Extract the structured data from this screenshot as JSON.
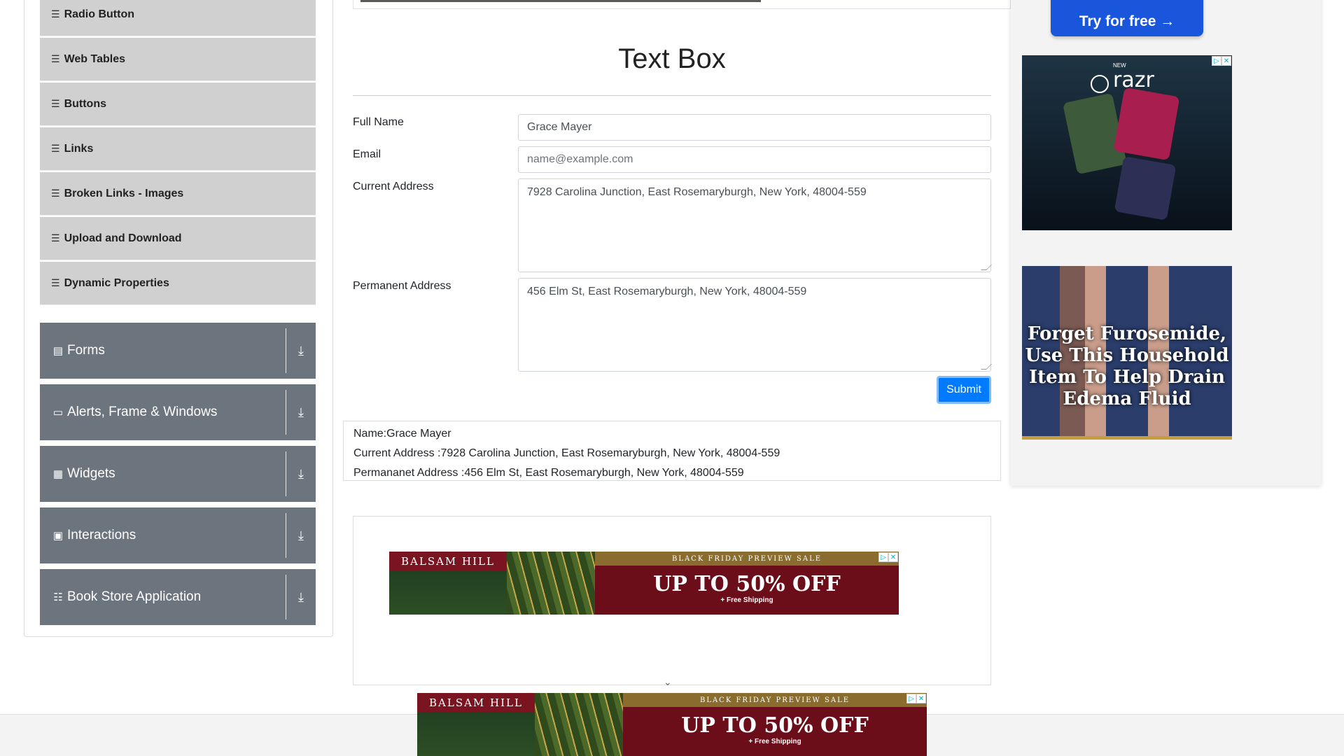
{
  "sidebar": {
    "elements_subitems": [
      {
        "label": "Radio Button"
      },
      {
        "label": "Web Tables"
      },
      {
        "label": "Buttons"
      },
      {
        "label": "Links"
      },
      {
        "label": "Broken Links - Images"
      },
      {
        "label": "Upload and Download"
      },
      {
        "label": "Dynamic Properties"
      }
    ],
    "groups": [
      {
        "label": "Forms",
        "icon": "form-icon"
      },
      {
        "label": "Alerts, Frame & Windows",
        "icon": "window-icon"
      },
      {
        "label": "Widgets",
        "icon": "widgets-icon"
      },
      {
        "label": "Interactions",
        "icon": "interactions-icon"
      },
      {
        "label": "Book Store Application",
        "icon": "books-icon"
      }
    ]
  },
  "main": {
    "title": "Text Box",
    "form": {
      "full_name_label": "Full Name",
      "full_name_value": "Grace Mayer",
      "email_label": "Email",
      "email_placeholder": "name@example.com",
      "current_address_label": "Current Address",
      "current_address_value": "7928 Carolina Junction, East Rosemaryburgh, New York, 48004-559",
      "permanent_address_label": "Permanent Address",
      "permanent_address_value": "456 Elm St, East Rosemaryburgh, New York, 48004-559",
      "submit_label": "Submit"
    },
    "output": {
      "name": "Name:Grace Mayer",
      "current_address": "Current Address :7928 Carolina Junction, East Rosemaryburgh, New York, 48004-559",
      "permanent_address": "Permananet Address :456 Elm St, East Rosemaryburgh, New York, 48004-559"
    }
  },
  "ads": {
    "banner": {
      "brand": "BALSAM HILL",
      "top": "BLACK FRIDAY PREVIEW SALE",
      "headline": "UP TO 50% OFF",
      "sub": "+ Free Shipping"
    },
    "try_button": "Try for free →",
    "razr": "razr",
    "razr_new": "NEW",
    "legs_text": "Forget Furosemide, Use This Household Item To Help Drain Edema Fluid"
  },
  "colors": {
    "accent": "#007bff",
    "sidebar_group": "#6c757d",
    "sidebar_item": "#d0d0d0"
  }
}
